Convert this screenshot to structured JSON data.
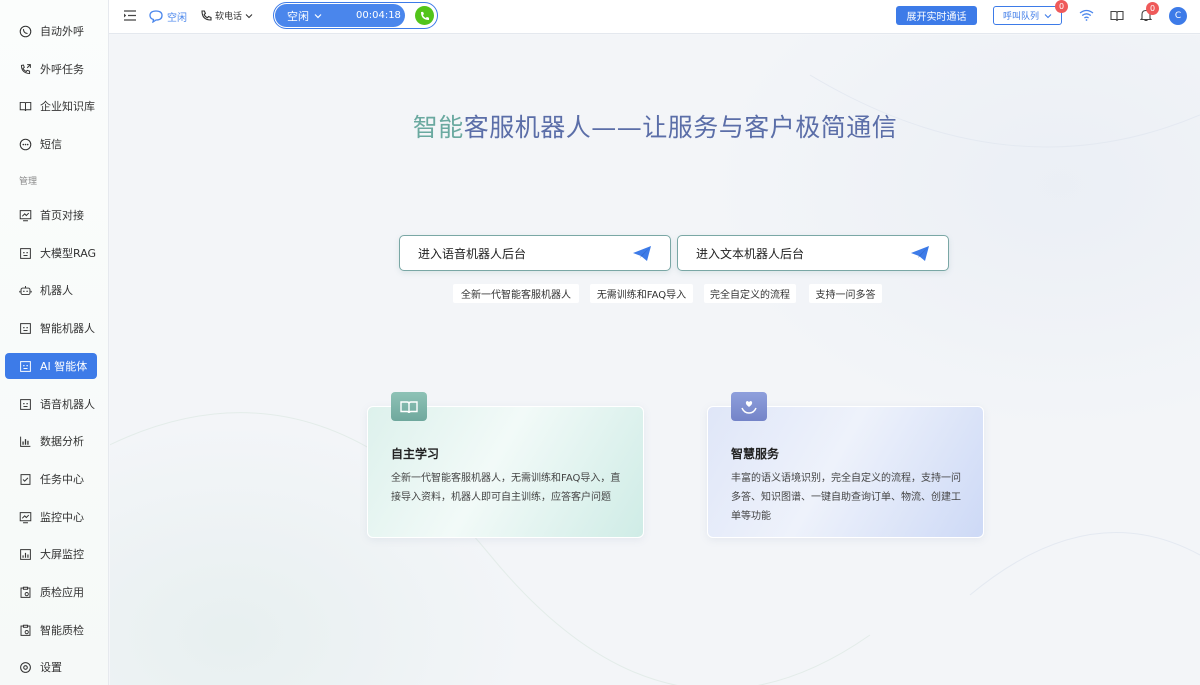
{
  "sidebar": {
    "items": [
      {
        "label": "自动外呼",
        "icon": "phone-icon"
      },
      {
        "label": "外呼任务",
        "icon": "phone-outgoing-icon"
      },
      {
        "label": "企业知识库",
        "icon": "book-icon"
      },
      {
        "label": "短信",
        "icon": "message-icon"
      },
      {
        "label": "首页对接",
        "icon": "chart-line-icon"
      },
      {
        "label": "大模型RAG",
        "icon": "robot-face-icon"
      },
      {
        "label": "机器人",
        "icon": "robot-icon"
      },
      {
        "label": "智能机器人",
        "icon": "robot-face-icon"
      },
      {
        "label": "AI 智能体",
        "icon": "robot-face-icon",
        "active": true
      },
      {
        "label": "语音机器人",
        "icon": "robot-face-icon"
      },
      {
        "label": "数据分析",
        "icon": "bar-chart-icon"
      },
      {
        "label": "任务中心",
        "icon": "checklist-icon"
      },
      {
        "label": "监控中心",
        "icon": "monitor-icon"
      },
      {
        "label": "大屏监控",
        "icon": "bar-chart-icon"
      },
      {
        "label": "质检应用",
        "icon": "clipboard-icon"
      },
      {
        "label": "智能质检",
        "icon": "clipboard-icon"
      },
      {
        "label": "设置",
        "icon": "gear-icon"
      }
    ],
    "section_label": "管理"
  },
  "topbar": {
    "agent_status": "空闲",
    "phone_mode": "软电话",
    "call_status": "空闲",
    "call_timer": "00:04:18",
    "expand_button": "展开实时通话",
    "queue_label": "呼叫队列",
    "queue_badge": "0",
    "notification_badge": "0",
    "avatar_letter": "C"
  },
  "main": {
    "title_highlight": "智能",
    "title_rest": "客服机器人——让服务与客户极简通信",
    "entry_voice": "进入语音机器人后台",
    "entry_text": "进入文本机器人后台",
    "tags": [
      "全新一代智能客服机器人",
      "无需训练和FAQ导入",
      "完全自定义的流程",
      "支持一问多答"
    ],
    "cards": [
      {
        "title": "自主学习",
        "text": "全新一代智能客服机器人，无需训练和FAQ导入，直接导入资料，机器人即可自主训练，应答客户问题",
        "icon": "open-book-icon"
      },
      {
        "title": "智慧服务",
        "text": "丰富的语义语境识别，完全自定义的流程，支持一问多答、知识图谱、一键自助查询订单、物流、创建工单等功能",
        "icon": "heart-hand-icon"
      }
    ]
  },
  "colors": {
    "accent": "#3d7be8",
    "call_green": "#52c41a",
    "badge_red": "#ef5a5a"
  }
}
